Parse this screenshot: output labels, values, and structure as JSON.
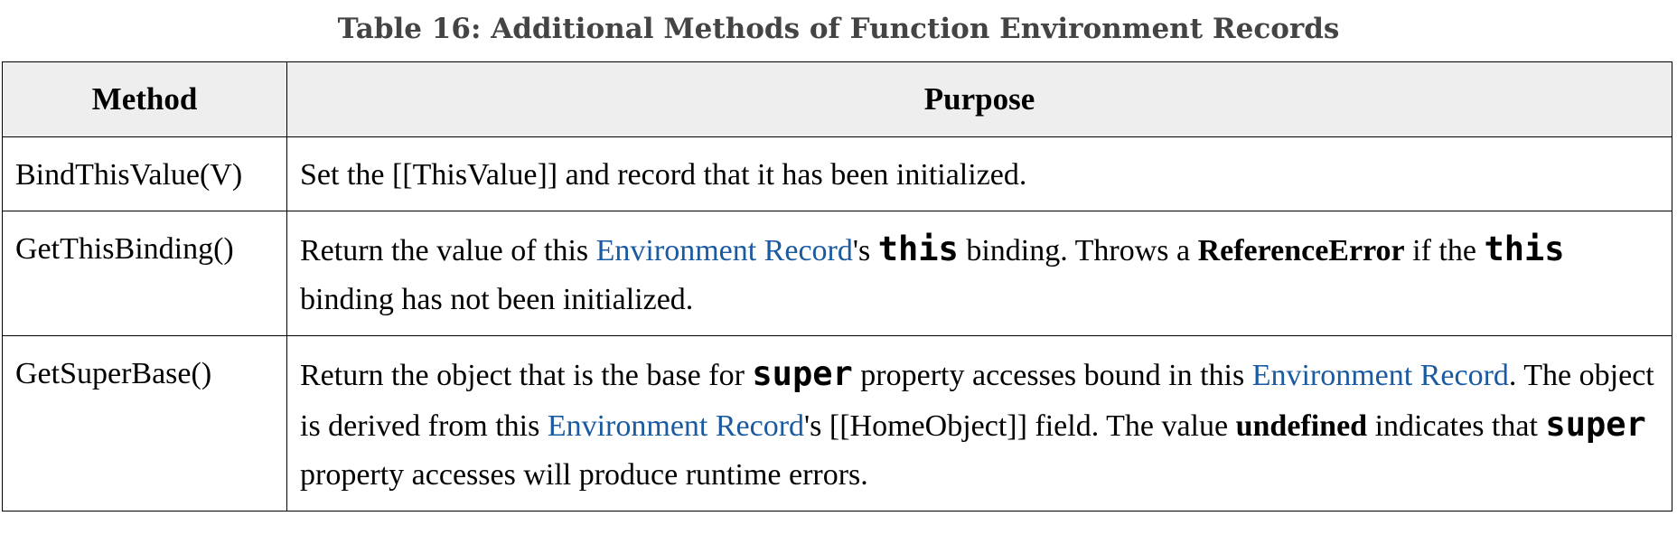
{
  "caption": "Table 16: Additional Methods of Function Environment Records",
  "table": {
    "headers": {
      "method": "Method",
      "purpose": "Purpose"
    },
    "rows": [
      {
        "method": "BindThisValue(V)",
        "purpose": {
          "t1": "Set the [[ThisValue]] and record that it has been initialized."
        }
      },
      {
        "method": "GetThisBinding()",
        "purpose": {
          "t1": "Return the value of this ",
          "link1": "Environment Record",
          "t2": "'s ",
          "code1": "this",
          "t3": " binding. Throws a ",
          "bold1": "ReferenceError",
          "t4": " if the ",
          "code2": "this",
          "t5": " binding has not been initialized."
        }
      },
      {
        "method": "GetSuperBase()",
        "purpose": {
          "t1": "Return the object that is the base for ",
          "code1": "super",
          "t2": " property accesses bound in this ",
          "link1": "Environment Record",
          "t3": ". The object is derived from this ",
          "link2": "Environment Record",
          "t4": "'s [[HomeObject]] field. The value ",
          "bold1": "undefined",
          "t5": " indicates that ",
          "code2": "super",
          "t6": " property accesses will produce runtime errors."
        }
      }
    ]
  },
  "colors": {
    "link": "#1a5aa0",
    "header_bg": "#eeeeee",
    "caption": "#444444"
  }
}
